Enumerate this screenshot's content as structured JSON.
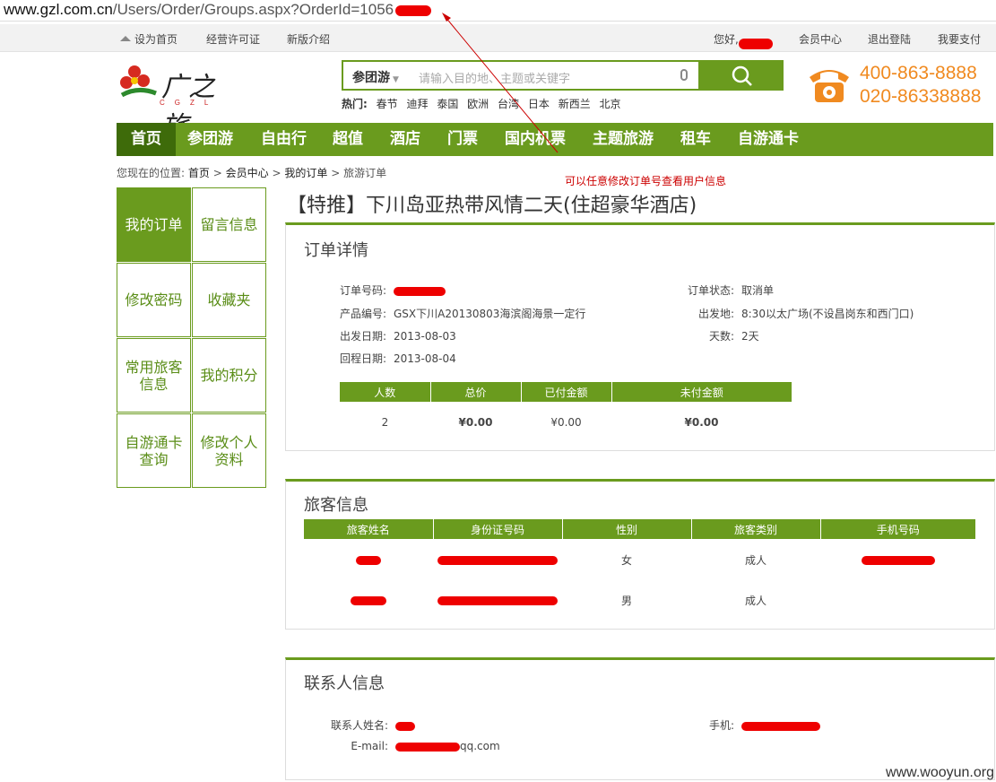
{
  "browser": {
    "url_host": "www.gzl.com.cn",
    "url_path": "/Users/Order/Groups.aspx?OrderId=1056"
  },
  "topbar": {
    "set_home": "设为首页",
    "license": "经营许可证",
    "new_version": "新版介绍",
    "hello": "您好,",
    "member_center": "会员中心",
    "logout": "退出登陆",
    "pay": "我要支付"
  },
  "logo": {
    "cn": "广之旅",
    "en": "CGZL"
  },
  "search": {
    "category": "参团游",
    "placeholder": "请输入目的地、主题或关键字"
  },
  "hot": {
    "label": "热门:",
    "items": [
      "春节",
      "迪拜",
      "泰国",
      "欧洲",
      "台湾",
      "日本",
      "新西兰",
      "北京"
    ]
  },
  "phones": [
    "400-863-8888",
    "020-86338888"
  ],
  "nav": [
    "首页",
    "参团游",
    "自由行",
    "超值",
    "酒店",
    "门票",
    "国内机票",
    "主题旅游",
    "租车",
    "自游通卡"
  ],
  "breadcrumb": {
    "prefix": "您现在的位置:",
    "home": "首页",
    "member": "会员中心",
    "orders": "我的订单",
    "current": "旅游订单",
    "sep": ">"
  },
  "annotation": "可以任意修改订单号查看用户信息",
  "sidebar": [
    {
      "label": "我的订单"
    },
    {
      "label": "留言信息"
    },
    {
      "label": "修改密码"
    },
    {
      "label": "收藏夹"
    },
    {
      "label": "常用旅客信息"
    },
    {
      "label": "我的积分"
    },
    {
      "label": "自游通卡查询"
    },
    {
      "label": "修改个人资料"
    }
  ],
  "product_title": "【特推】下川岛亚热带风情二天(住超豪华酒店)",
  "order": {
    "heading": "订单详情",
    "order_no_label": "订单号码:",
    "status_label": "订单状态:",
    "status_value": "取消单",
    "product_no_label": "产品编号:",
    "product_no_value": "GSX下川A20130803海滨阁海景一定行",
    "depart_place_label": "出发地:",
    "depart_place_value": "8:30以太广场(不设昌岗东和西门口)",
    "depart_date_label": "出发日期:",
    "depart_date_value": "2013-08-03",
    "days_label": "天数:",
    "days_value": "2天",
    "return_date_label": "回程日期:",
    "return_date_value": "2013-08-04",
    "table": {
      "headers": [
        "人数",
        "总价",
        "已付金额",
        "未付金额"
      ],
      "row": [
        "2",
        "¥0.00",
        "¥0.00",
        "¥0.00"
      ]
    }
  },
  "travelers": {
    "heading": "旅客信息",
    "headers": [
      "旅客姓名",
      "身份证号码",
      "性别",
      "旅客类别",
      "手机号码"
    ],
    "rows": [
      {
        "gender": "女",
        "type": "成人"
      },
      {
        "gender": "男",
        "type": "成人"
      }
    ]
  },
  "contact": {
    "heading": "联系人信息",
    "name_label": "联系人姓名:",
    "mobile_label": "手机:",
    "email_label": "E-mail:",
    "email_suffix": "qq.com"
  },
  "watermark": "www.wooyun.org",
  "colors": {
    "brand_green": "#6a9b1e",
    "active_green": "#3e6b0a",
    "phone_orange": "#f08a20",
    "alert_red": "#c00000"
  }
}
